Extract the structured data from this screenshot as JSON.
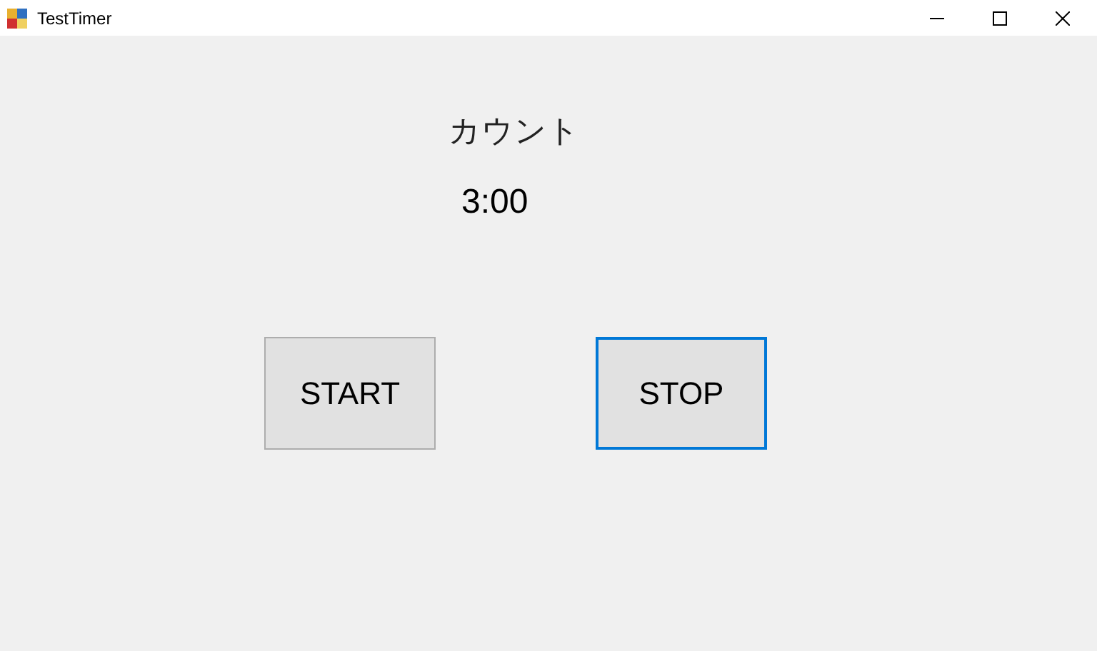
{
  "window": {
    "title": "TestTimer"
  },
  "label": "カウント",
  "time": "3:00",
  "buttons": [
    {
      "label": "START",
      "focused": false
    },
    {
      "label": "STOP",
      "focused": true
    }
  ]
}
